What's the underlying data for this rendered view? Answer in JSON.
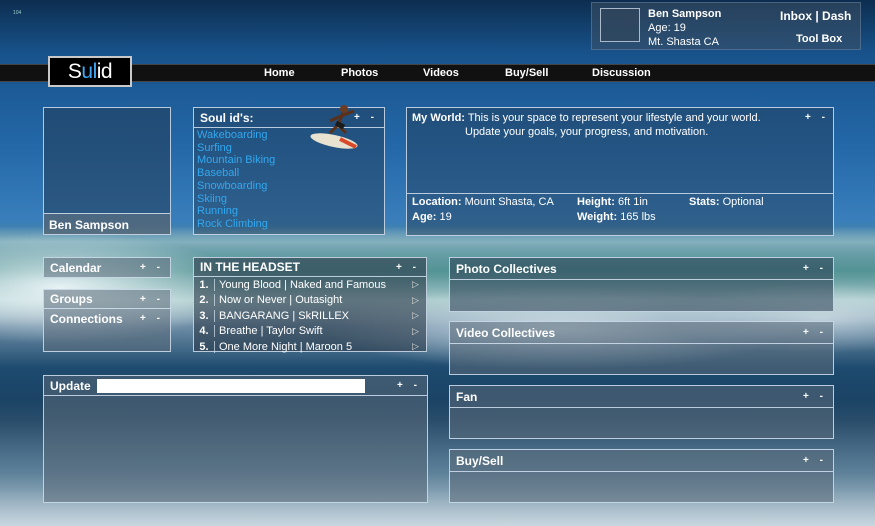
{
  "corner_text": "104",
  "brand": {
    "logo_s": "S",
    "logo_ul": "ul",
    "logo_id": " id"
  },
  "nav": [
    "Home",
    "Photos",
    "Videos",
    "Buy/Sell",
    "Discussion"
  ],
  "profile": {
    "name": "Ben Sampson",
    "age": "Age: 19",
    "location": "Mt. Shasta  CA",
    "inbox_dash": "Inbox | Dash",
    "toolbox": "Tool Box"
  },
  "avatar_panel": {
    "name": "Ben Sampson"
  },
  "soul_ids": {
    "title": "Soul id's:",
    "items": [
      "Wakeboarding",
      "Surfing",
      "Mountain Biking",
      "Baseball",
      "Snowboarding",
      "Skiing",
      "Running",
      "Rock Climbing"
    ]
  },
  "my_world": {
    "title": "My World:",
    "line1": "This is your space to represent your lifestyle and your world.",
    "line2": "Update your goals, your progress, and motivation.",
    "location_label": "Location:",
    "location_value": "Mount Shasta, CA",
    "age_label": "Age:",
    "age_value": "19",
    "height_label": "Height:",
    "height_value": "6ft 1in",
    "weight_label": "Weight:",
    "weight_value": "165 lbs",
    "stats_label": "Stats:",
    "stats_value": "Optional"
  },
  "calendar": {
    "title": "Calendar"
  },
  "groups": {
    "title": "Groups"
  },
  "connections": {
    "title": "Connections"
  },
  "headset": {
    "title": "IN THE HEADSET",
    "tracks": [
      {
        "num": "1.",
        "title": "Young Blood | Naked and Famous"
      },
      {
        "num": "2.",
        "title": "Now or Never | Outasight"
      },
      {
        "num": "3.",
        "title": "BANGARANG | SkRILLEX"
      },
      {
        "num": "4.",
        "title": "Breathe | Taylor Swift"
      },
      {
        "num": "5.",
        "title": "One More Night | Maroon 5"
      }
    ]
  },
  "update": {
    "title": "Update",
    "input_value": ""
  },
  "photo_collectives": {
    "title": "Photo Collectives"
  },
  "video_collectives": {
    "title": "Video Collectives"
  },
  "fan": {
    "title": "Fan"
  },
  "buysell": {
    "title": "Buy/Sell"
  },
  "controls": {
    "plus_minus": "+ -"
  }
}
